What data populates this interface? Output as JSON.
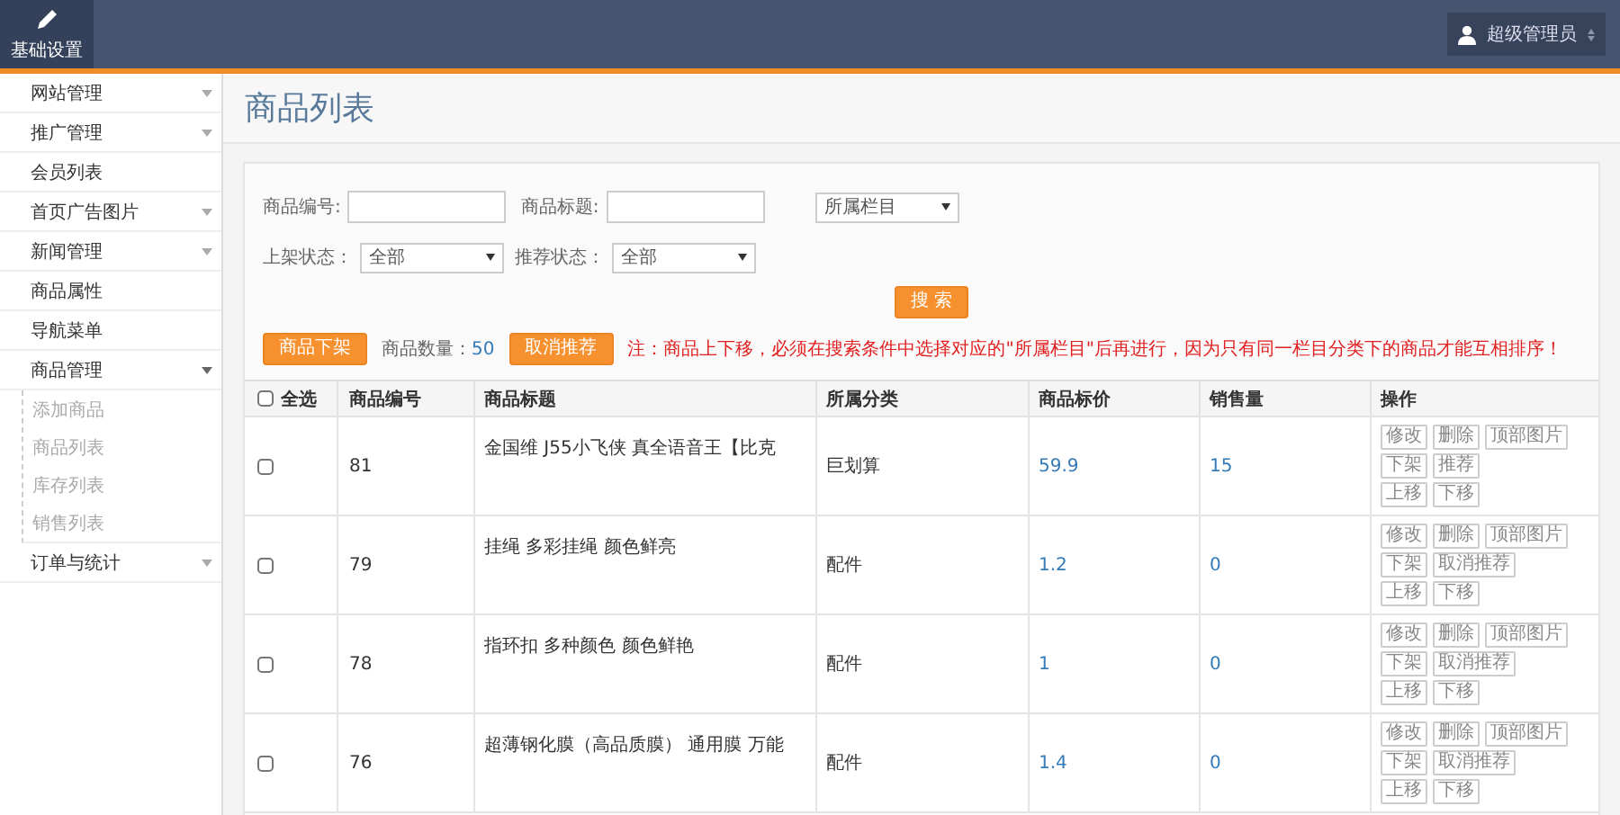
{
  "header": {
    "tabs": [
      {
        "label": "基础设置",
        "selected": true
      }
    ],
    "user": {
      "name": "超级管理员"
    }
  },
  "sidebar": {
    "items": [
      {
        "label": "网站管理",
        "expandable": true,
        "expanded": false
      },
      {
        "label": "推广管理",
        "expandable": true,
        "expanded": false
      },
      {
        "label": "会员列表",
        "expandable": false
      },
      {
        "label": "首页广告图片",
        "expandable": true,
        "expanded": false
      },
      {
        "label": "新闻管理",
        "expandable": true,
        "expanded": false
      },
      {
        "label": "商品属性",
        "expandable": false
      },
      {
        "label": "导航菜单",
        "expandable": false
      },
      {
        "label": "商品管理",
        "expandable": true,
        "expanded": true,
        "children": [
          {
            "label": "添加商品"
          },
          {
            "label": "商品列表"
          },
          {
            "label": "库存列表"
          },
          {
            "label": "销售列表"
          }
        ]
      },
      {
        "label": "订单与统计",
        "expandable": true,
        "expanded": false
      }
    ]
  },
  "page_title": "商品列表",
  "filters": {
    "row_1": [
      {
        "kind": "input",
        "label": "商品编号:"
      },
      {
        "kind": "input",
        "label": "商品标题:"
      },
      {
        "kind": "select",
        "value": "所属栏目"
      }
    ],
    "row_2": [
      {
        "kind": "select",
        "label": "上架状态：",
        "value": "全部"
      },
      {
        "kind": "select",
        "label": "推荐状态：",
        "value": "全部"
      }
    ],
    "search_button": "搜 索"
  },
  "toolbar": {
    "unlist_button": "商品下架",
    "count_label": "商品数量：",
    "count": "50",
    "unrecommend_button": "取消推荐",
    "note": "注：商品上下移，必须在搜索条件中选择对应的\"所属栏目\"后再进行，因为只有同一栏目分类下的商品才能互相排序！"
  },
  "table": {
    "select_all": {
      "label": "全选",
      "checked": false
    },
    "columns": [
      "商品编号",
      "商品标题",
      "所属分类",
      "商品标价",
      "销售量",
      "操作"
    ],
    "rows": [
      {
        "checked": false,
        "id": "81",
        "title": "金国维 J55小飞侠 真全语音王【比克",
        "category": "巨划算",
        "price": "59.9",
        "sales": "15",
        "actions": [
          [
            "修改",
            "删除",
            "顶部图片"
          ],
          [
            "下架",
            "推荐"
          ],
          [
            "上移",
            "下移"
          ]
        ]
      },
      {
        "checked": false,
        "id": "79",
        "title": "挂绳 多彩挂绳 颜色鲜亮",
        "category": "配件",
        "price": "1.2",
        "sales": "0",
        "actions": [
          [
            "修改",
            "删除",
            "顶部图片"
          ],
          [
            "下架",
            "取消推荐"
          ],
          [
            "上移",
            "下移"
          ]
        ]
      },
      {
        "checked": false,
        "id": "78",
        "title": "指环扣 多种颜色 颜色鲜艳",
        "category": "配件",
        "price": "1",
        "sales": "0",
        "actions": [
          [
            "修改",
            "删除",
            "顶部图片"
          ],
          [
            "下架",
            "取消推荐"
          ],
          [
            "上移",
            "下移"
          ]
        ]
      },
      {
        "checked": false,
        "id": "76",
        "title": "超薄钢化膜（高品质膜） 通用膜 万能",
        "category": "配件",
        "price": "1.4",
        "sales": "0",
        "actions": [
          [
            "修改",
            "删除",
            "顶部图片"
          ],
          [
            "下架",
            "取消推荐"
          ],
          [
            "上移",
            "下移"
          ]
        ]
      }
    ]
  }
}
